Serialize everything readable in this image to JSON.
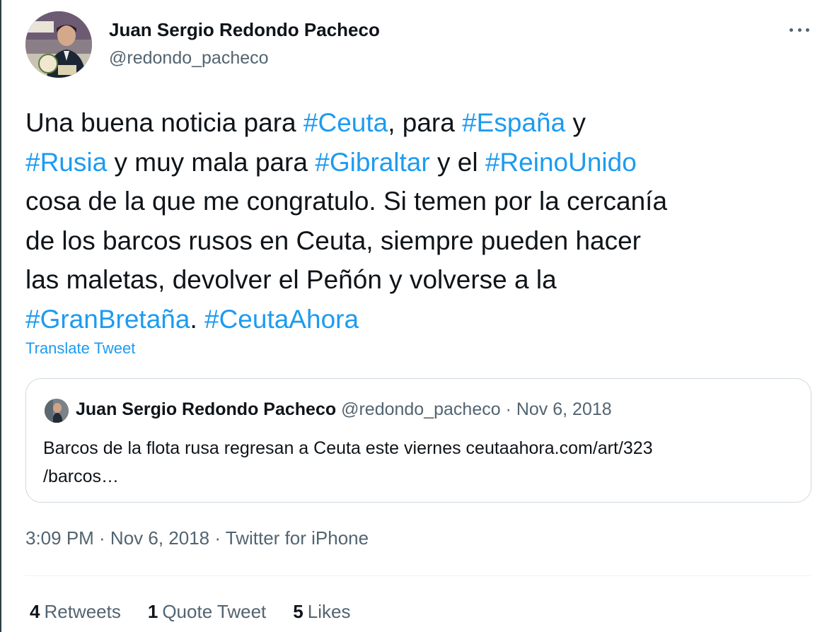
{
  "author": {
    "name": "Juan Sergio Redondo Pacheco",
    "handle": "@redondo_pacheco"
  },
  "tweet": {
    "text_segments": [
      {
        "text": "Una buena noticia para ",
        "tag": false
      },
      {
        "text": "#Ceuta",
        "tag": true
      },
      {
        "text": ", para ",
        "tag": false
      },
      {
        "text": "#España",
        "tag": true
      },
      {
        "text": " y\n",
        "tag": false
      },
      {
        "text": "#Rusia",
        "tag": true
      },
      {
        "text": " y muy mala para ",
        "tag": false
      },
      {
        "text": "#Gibraltar",
        "tag": true
      },
      {
        "text": " y el ",
        "tag": false
      },
      {
        "text": "#ReinoUnido",
        "tag": true
      },
      {
        "text": "\ncosa de la que me congratulo. Si temen por la cercanía\nde los barcos rusos en Ceuta, siempre pueden hacer\nlas maletas, devolver el Peñón y volverse a la\n",
        "tag": false
      },
      {
        "text": "#GranBretaña",
        "tag": true
      },
      {
        "text": ". ",
        "tag": false
      },
      {
        "text": "#CeutaAhora",
        "tag": true
      }
    ],
    "translate_label": "Translate Tweet",
    "timestamp": "3:09 PM · Nov 6, 2018 · Twitter for iPhone"
  },
  "quote": {
    "name": "Juan Sergio Redondo Pacheco",
    "meta": " @redondo_pacheco · Nov 6, 2018",
    "text": "Barcos de la flota rusa regresan a Ceuta este viernes ceutaahora.com/art/323\n/barcos…"
  },
  "stats": {
    "retweets_count": "4",
    "retweets_label": "Retweets",
    "quotes_count": "1",
    "quotes_label": "Quote Tweet",
    "likes_count": "5",
    "likes_label": "Likes"
  },
  "icons": {
    "more": "more-horizontal-icon"
  },
  "colors": {
    "link": "#1d9bf0",
    "text": "#0f1419",
    "secondary": "#536471",
    "border": "#cfd9de"
  }
}
